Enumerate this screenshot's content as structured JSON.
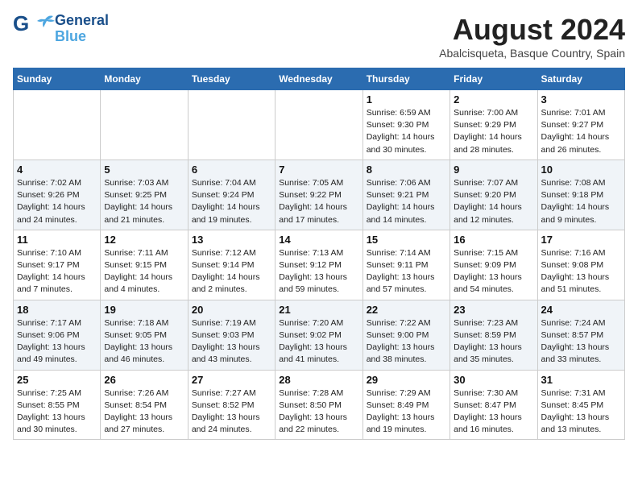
{
  "logo": {
    "line1": "General",
    "line2": "Blue"
  },
  "title": "August 2024",
  "subtitle": "Abalcisqueta, Basque Country, Spain",
  "days_of_week": [
    "Sunday",
    "Monday",
    "Tuesday",
    "Wednesday",
    "Thursday",
    "Friday",
    "Saturday"
  ],
  "weeks": [
    [
      {
        "day": "",
        "info": ""
      },
      {
        "day": "",
        "info": ""
      },
      {
        "day": "",
        "info": ""
      },
      {
        "day": "",
        "info": ""
      },
      {
        "day": "1",
        "info": "Sunrise: 6:59 AM\nSunset: 9:30 PM\nDaylight: 14 hours\nand 30 minutes."
      },
      {
        "day": "2",
        "info": "Sunrise: 7:00 AM\nSunset: 9:29 PM\nDaylight: 14 hours\nand 28 minutes."
      },
      {
        "day": "3",
        "info": "Sunrise: 7:01 AM\nSunset: 9:27 PM\nDaylight: 14 hours\nand 26 minutes."
      }
    ],
    [
      {
        "day": "4",
        "info": "Sunrise: 7:02 AM\nSunset: 9:26 PM\nDaylight: 14 hours\nand 24 minutes."
      },
      {
        "day": "5",
        "info": "Sunrise: 7:03 AM\nSunset: 9:25 PM\nDaylight: 14 hours\nand 21 minutes."
      },
      {
        "day": "6",
        "info": "Sunrise: 7:04 AM\nSunset: 9:24 PM\nDaylight: 14 hours\nand 19 minutes."
      },
      {
        "day": "7",
        "info": "Sunrise: 7:05 AM\nSunset: 9:22 PM\nDaylight: 14 hours\nand 17 minutes."
      },
      {
        "day": "8",
        "info": "Sunrise: 7:06 AM\nSunset: 9:21 PM\nDaylight: 14 hours\nand 14 minutes."
      },
      {
        "day": "9",
        "info": "Sunrise: 7:07 AM\nSunset: 9:20 PM\nDaylight: 14 hours\nand 12 minutes."
      },
      {
        "day": "10",
        "info": "Sunrise: 7:08 AM\nSunset: 9:18 PM\nDaylight: 14 hours\nand 9 minutes."
      }
    ],
    [
      {
        "day": "11",
        "info": "Sunrise: 7:10 AM\nSunset: 9:17 PM\nDaylight: 14 hours\nand 7 minutes."
      },
      {
        "day": "12",
        "info": "Sunrise: 7:11 AM\nSunset: 9:15 PM\nDaylight: 14 hours\nand 4 minutes."
      },
      {
        "day": "13",
        "info": "Sunrise: 7:12 AM\nSunset: 9:14 PM\nDaylight: 14 hours\nand 2 minutes."
      },
      {
        "day": "14",
        "info": "Sunrise: 7:13 AM\nSunset: 9:12 PM\nDaylight: 13 hours\nand 59 minutes."
      },
      {
        "day": "15",
        "info": "Sunrise: 7:14 AM\nSunset: 9:11 PM\nDaylight: 13 hours\nand 57 minutes."
      },
      {
        "day": "16",
        "info": "Sunrise: 7:15 AM\nSunset: 9:09 PM\nDaylight: 13 hours\nand 54 minutes."
      },
      {
        "day": "17",
        "info": "Sunrise: 7:16 AM\nSunset: 9:08 PM\nDaylight: 13 hours\nand 51 minutes."
      }
    ],
    [
      {
        "day": "18",
        "info": "Sunrise: 7:17 AM\nSunset: 9:06 PM\nDaylight: 13 hours\nand 49 minutes."
      },
      {
        "day": "19",
        "info": "Sunrise: 7:18 AM\nSunset: 9:05 PM\nDaylight: 13 hours\nand 46 minutes."
      },
      {
        "day": "20",
        "info": "Sunrise: 7:19 AM\nSunset: 9:03 PM\nDaylight: 13 hours\nand 43 minutes."
      },
      {
        "day": "21",
        "info": "Sunrise: 7:20 AM\nSunset: 9:02 PM\nDaylight: 13 hours\nand 41 minutes."
      },
      {
        "day": "22",
        "info": "Sunrise: 7:22 AM\nSunset: 9:00 PM\nDaylight: 13 hours\nand 38 minutes."
      },
      {
        "day": "23",
        "info": "Sunrise: 7:23 AM\nSunset: 8:59 PM\nDaylight: 13 hours\nand 35 minutes."
      },
      {
        "day": "24",
        "info": "Sunrise: 7:24 AM\nSunset: 8:57 PM\nDaylight: 13 hours\nand 33 minutes."
      }
    ],
    [
      {
        "day": "25",
        "info": "Sunrise: 7:25 AM\nSunset: 8:55 PM\nDaylight: 13 hours\nand 30 minutes."
      },
      {
        "day": "26",
        "info": "Sunrise: 7:26 AM\nSunset: 8:54 PM\nDaylight: 13 hours\nand 27 minutes."
      },
      {
        "day": "27",
        "info": "Sunrise: 7:27 AM\nSunset: 8:52 PM\nDaylight: 13 hours\nand 24 minutes."
      },
      {
        "day": "28",
        "info": "Sunrise: 7:28 AM\nSunset: 8:50 PM\nDaylight: 13 hours\nand 22 minutes."
      },
      {
        "day": "29",
        "info": "Sunrise: 7:29 AM\nSunset: 8:49 PM\nDaylight: 13 hours\nand 19 minutes."
      },
      {
        "day": "30",
        "info": "Sunrise: 7:30 AM\nSunset: 8:47 PM\nDaylight: 13 hours\nand 16 minutes."
      },
      {
        "day": "31",
        "info": "Sunrise: 7:31 AM\nSunset: 8:45 PM\nDaylight: 13 hours\nand 13 minutes."
      }
    ]
  ]
}
